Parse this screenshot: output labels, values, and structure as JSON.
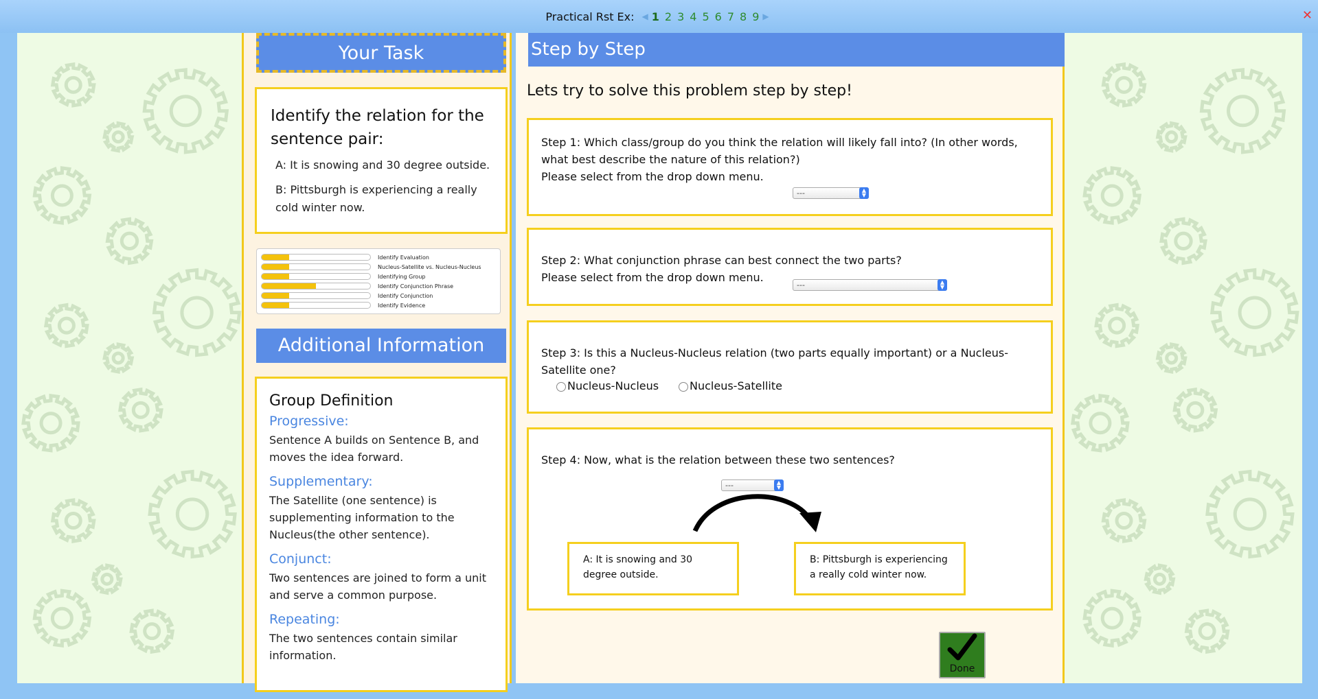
{
  "topbar": {
    "nav_label": "Practical Rst Ex:",
    "pages": [
      "1",
      "2",
      "3",
      "4",
      "5",
      "6",
      "7",
      "8",
      "9"
    ],
    "current_page": "1",
    "prev_icon": "triangle-left-icon",
    "next_icon": "triangle-right-icon",
    "close_icon": "close-x-icon"
  },
  "task": {
    "header": "Your Task",
    "title": "Identify the relation for the sentence pair:",
    "sentence_a": "A: It is snowing and 30 degree outside.",
    "sentence_b": "B: Pittsburgh is experiencing a really cold winter now."
  },
  "progress": [
    {
      "label": "Identify Evaluation",
      "fraction": 0.25
    },
    {
      "label": "Nucleus-Satellite vs. Nucleus-Nucleus",
      "fraction": 0.25
    },
    {
      "label": "Identifying Group",
      "fraction": 0.25
    },
    {
      "label": "Identify Conjunction Phrase",
      "fraction": 0.5
    },
    {
      "label": "Identify Conjunction",
      "fraction": 0.25
    },
    {
      "label": "Identify Evidence",
      "fraction": 0.25
    }
  ],
  "additional": {
    "header": "Additional Information",
    "group_title": "Group Definition",
    "definitions": [
      {
        "term": "Progressive:",
        "desc": "Sentence A builds on Sentence B, and moves the idea forward."
      },
      {
        "term": "Supplementary:",
        "desc": "The Satellite (one sentence) is supplementing information to the Nucleus(the other sentence)."
      },
      {
        "term": "Conjunct:",
        "desc": "Two sentences are joined to form a unit and serve a common purpose."
      },
      {
        "term": "Repeating:",
        "desc": "The two sentences contain similar information."
      }
    ]
  },
  "steps": {
    "header": "Step by Step",
    "intro": "Lets try to solve this problem step by step!",
    "step1_text": "Step 1: Which class/group do you think the relation will likely fall into? (In other words, what best describe the nature of this relation?)",
    "step1_instr": "Please select from the drop down menu.",
    "step1_value": "---",
    "step2_text": "Step 2: What conjunction phrase can best connect the two parts?",
    "step2_instr": "Please select from the drop down menu.",
    "step2_value": "---",
    "step3_text": "Step 3: Is this a Nucleus-Nucleus relation (two parts equally important) or a Nucleus-Satellite one?",
    "step3_opt1": "Nucleus-Nucleus",
    "step3_opt2": "Nucleus-Satellite",
    "step4_text": "Step 4: Now, what is the relation between these two sentences?",
    "step4_value": "---",
    "box_a": "A: It is snowing and 30 degree outside.",
    "box_b": "B: Pittsburgh is experiencing a really cold winter now."
  },
  "done": {
    "label": "Done",
    "icon": "checkmark-icon",
    "color": "#2f7d1e"
  },
  "colors": {
    "accent_blue": "#5b8de6",
    "border_yellow": "#f5cf1e",
    "term_blue": "#4a86e0"
  }
}
